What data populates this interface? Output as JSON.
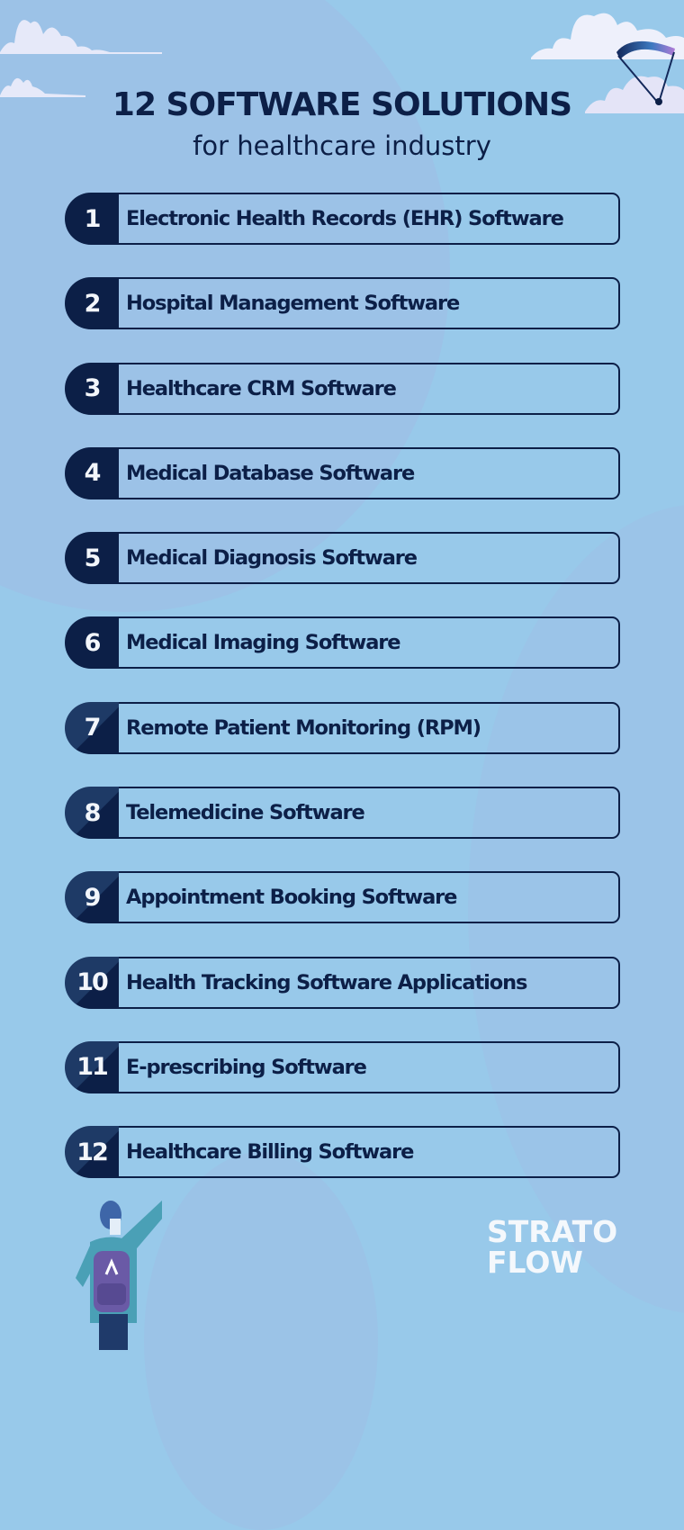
{
  "header": {
    "title": "12 SOFTWARE SOLUTIONS",
    "subtitle": "for healthcare industry"
  },
  "items": [
    {
      "number": "1",
      "label": "Electronic Health Records (EHR) Software"
    },
    {
      "number": "2",
      "label": "Hospital Management Software"
    },
    {
      "number": "3",
      "label": "Healthcare CRM Software"
    },
    {
      "number": "4",
      "label": "Medical Database Software"
    },
    {
      "number": "5",
      "label": "Medical Diagnosis Software"
    },
    {
      "number": "6",
      "label": "Medical Imaging Software"
    },
    {
      "number": "7",
      "label": "Remote Patient Monitoring (RPM)"
    },
    {
      "number": "8",
      "label": "Telemedicine Software"
    },
    {
      "number": "9",
      "label": "Appointment Booking Software"
    },
    {
      "number": "10",
      "label": "Health Tracking Software Applications"
    },
    {
      "number": "11",
      "label": "E-prescribing Software"
    },
    {
      "number": "12",
      "label": "Healthcare Billing Software"
    }
  ],
  "logo": {
    "line1": "STRATO",
    "line2": "FLOW"
  },
  "colors": {
    "background": "#98c9ea",
    "navy": "#0c1f47",
    "logo": "#f4f8fc"
  }
}
